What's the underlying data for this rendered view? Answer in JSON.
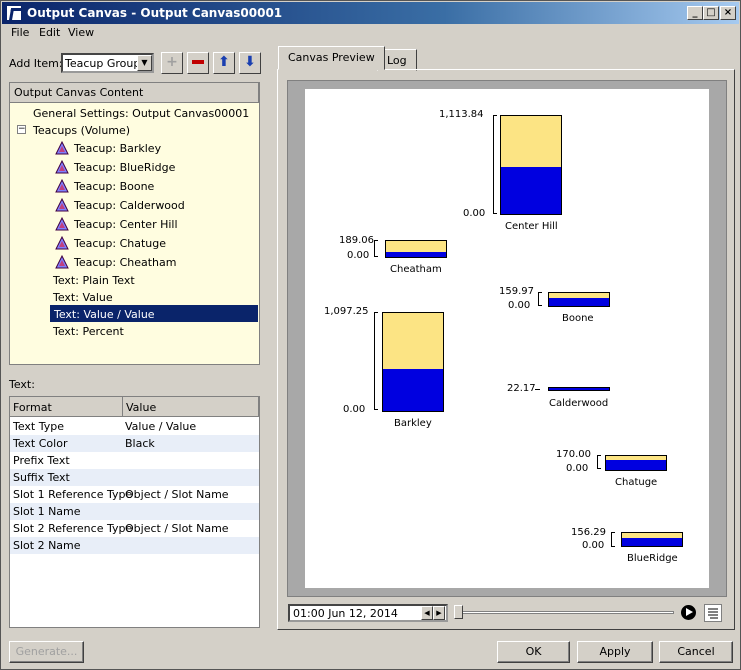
{
  "window": {
    "title": "Output Canvas - Output Canvas00001"
  },
  "menu": [
    "File",
    "Edit",
    "View"
  ],
  "toolbar": {
    "add_item_label": "Add Item:",
    "add_item_value": "Teacup Group"
  },
  "tree": {
    "header": "Output Canvas Content",
    "items": [
      {
        "label": "General Settings: Output Canvas00001"
      },
      {
        "label": "Teacups (Volume)"
      },
      {
        "label": "Teacup: Barkley"
      },
      {
        "label": "Teacup: BlueRidge"
      },
      {
        "label": "Teacup: Boone"
      },
      {
        "label": "Teacup: Calderwood"
      },
      {
        "label": "Teacup: Center Hill"
      },
      {
        "label": "Teacup: Chatuge"
      },
      {
        "label": "Teacup: Cheatham"
      },
      {
        "label": "Text: Plain Text"
      },
      {
        "label": "Text: Value"
      },
      {
        "label": "Text: Value / Value"
      },
      {
        "label": "Text: Percent"
      }
    ]
  },
  "properties": {
    "section_label": "Text:",
    "col_format": "Format",
    "col_value": "Value",
    "rows": [
      {
        "format": "Text Type",
        "value": "Value / Value"
      },
      {
        "format": "Text Color",
        "value": "Black"
      },
      {
        "format": "Prefix Text",
        "value": ""
      },
      {
        "format": "Suffix Text",
        "value": ""
      },
      {
        "format": "Slot 1 Reference Type",
        "value": "Object / Slot Name"
      },
      {
        "format": "Slot 1 Name",
        "value": ""
      },
      {
        "format": "Slot 2 Reference Type",
        "value": "Object / Slot Name"
      },
      {
        "format": "Slot 2 Name",
        "value": ""
      }
    ]
  },
  "tabs": [
    "Canvas Preview",
    "Log"
  ],
  "teacups": [
    {
      "name": "Center Hill",
      "max_label": "1,113.84",
      "min_label": "0.00",
      "fill": 0.48
    },
    {
      "name": "Cheatham",
      "max_label": "189.06",
      "min_label": "0.00",
      "fill": 0.3
    },
    {
      "name": "Boone",
      "max_label": "159.97",
      "min_label": "0.00",
      "fill": 0.6
    },
    {
      "name": "Barkley",
      "max_label": "1,097.25",
      "min_label": "0.00",
      "fill": 0.43
    },
    {
      "name": "Calderwood",
      "max_label": "22.17",
      "min_label": "",
      "fill": 1.0
    },
    {
      "name": "Chatuge",
      "max_label": "170.00",
      "min_label": "0.00",
      "fill": 0.7
    },
    {
      "name": "BlueRidge",
      "max_label": "156.29",
      "min_label": "0.00",
      "fill": 0.65
    }
  ],
  "timeline": {
    "value": "01:00 Jun 12, 2014"
  },
  "buttons": {
    "generate": "Generate...",
    "ok": "OK",
    "apply": "Apply",
    "cancel": "Cancel"
  },
  "colors": {
    "teacup_empty": "#fce484",
    "teacup_fill": "#0000e0",
    "selection": "#0a246a"
  }
}
